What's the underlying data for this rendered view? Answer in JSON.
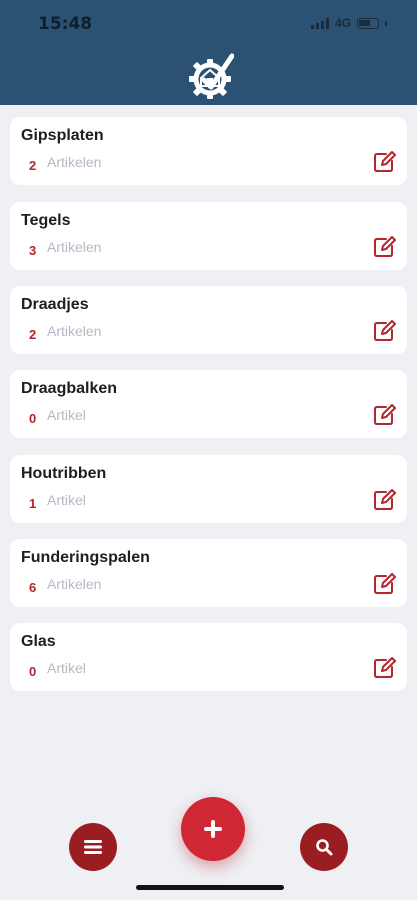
{
  "status_bar": {
    "time": "15:48",
    "network": "4G"
  },
  "colors": {
    "header": "#2b5173",
    "accent": "#b3262d",
    "fab": "#d02734",
    "fab_dark": "#9a1d22"
  },
  "categories": [
    {
      "name": "Gipsplaten",
      "count": "2",
      "unit": "Artikelen"
    },
    {
      "name": "Tegels",
      "count": "3",
      "unit": "Artikelen"
    },
    {
      "name": "Draadjes",
      "count": "2",
      "unit": "Artikelen"
    },
    {
      "name": "Draagbalken",
      "count": "0",
      "unit": "Artikel"
    },
    {
      "name": "Houtribben",
      "count": "1",
      "unit": "Artikel"
    },
    {
      "name": "Funderingspalen",
      "count": "6",
      "unit": "Artikelen"
    },
    {
      "name": "Glas",
      "count": "0",
      "unit": "Artikel"
    }
  ],
  "icons": {
    "logo": "gear-house-check-logo",
    "edit": "edit-icon",
    "menu": "menu-icon",
    "add": "plus-icon",
    "search": "search-icon"
  }
}
